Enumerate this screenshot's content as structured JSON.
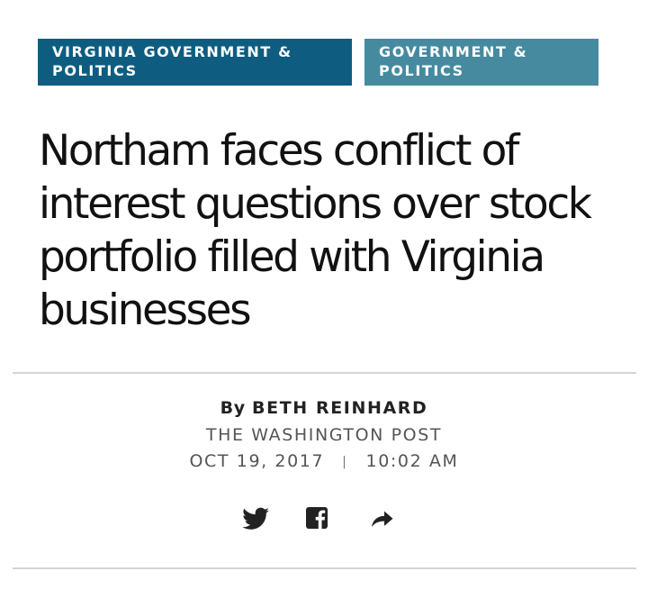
{
  "sections": {
    "primary_label": "VIRGINIA GOVERNMENT & POLITICS",
    "secondary_label": "GOVERNMENT & POLITICS"
  },
  "article": {
    "headline": "Northam faces conflict of interest questions over stock portfolio filled with Virginia businesses",
    "byline_prefix": "By",
    "author": "BETH REINHARD",
    "publisher": "THE WASHINGTON POST",
    "date": "OCT 19, 2017",
    "date_separator": "|",
    "time": "10:02 AM"
  },
  "share": {
    "icons": [
      "twitter-icon",
      "facebook-icon",
      "share-arrow-icon"
    ]
  },
  "colors": {
    "primary_tag": "#0e5d80",
    "secondary_tag": "#468a9f",
    "headline_text": "#111111",
    "meta_text": "#555555",
    "icon": "#222222",
    "divider": "#d5d5d5"
  }
}
